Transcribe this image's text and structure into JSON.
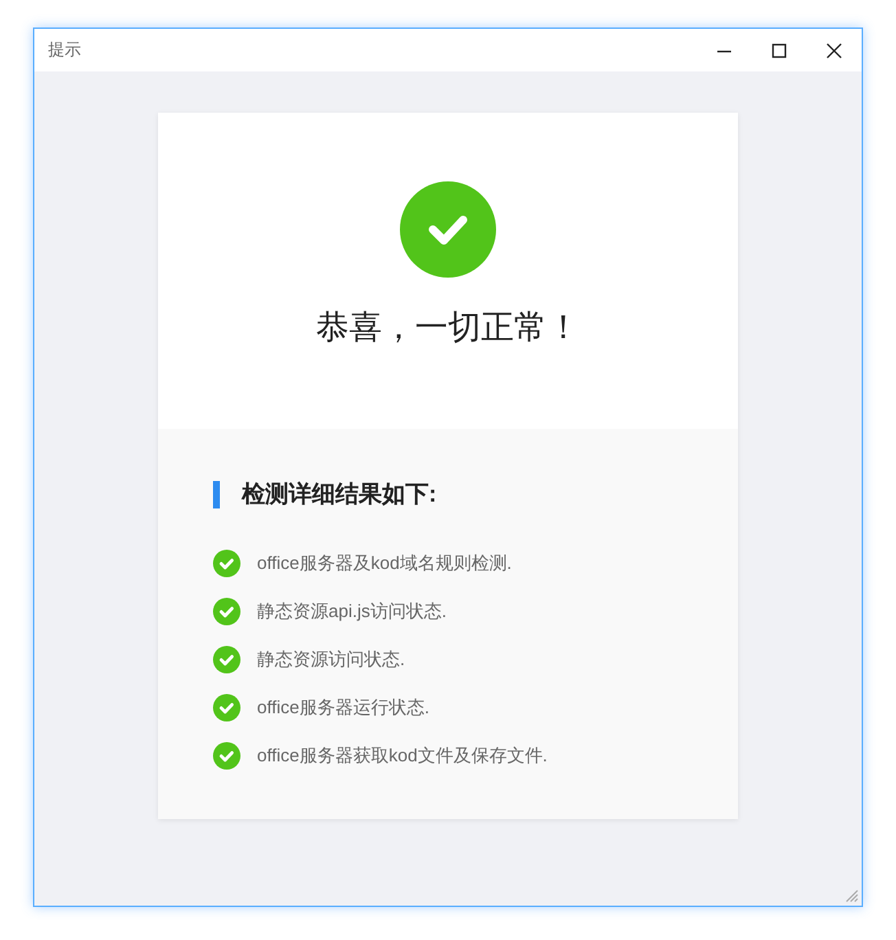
{
  "window": {
    "title": "提示"
  },
  "result": {
    "passed": true,
    "message": "恭喜，一切正常！"
  },
  "details": {
    "heading": "检测详细结果如下:",
    "items": [
      {
        "label": "office服务器及kod域名规则检测.",
        "passed": true
      },
      {
        "label": "静态资源api.js访问状态.",
        "passed": true
      },
      {
        "label": "静态资源访问状态.",
        "passed": true
      },
      {
        "label": "office服务器运行状态.",
        "passed": true
      },
      {
        "label": "office服务器获取kod文件及保存文件.",
        "passed": true
      }
    ]
  }
}
